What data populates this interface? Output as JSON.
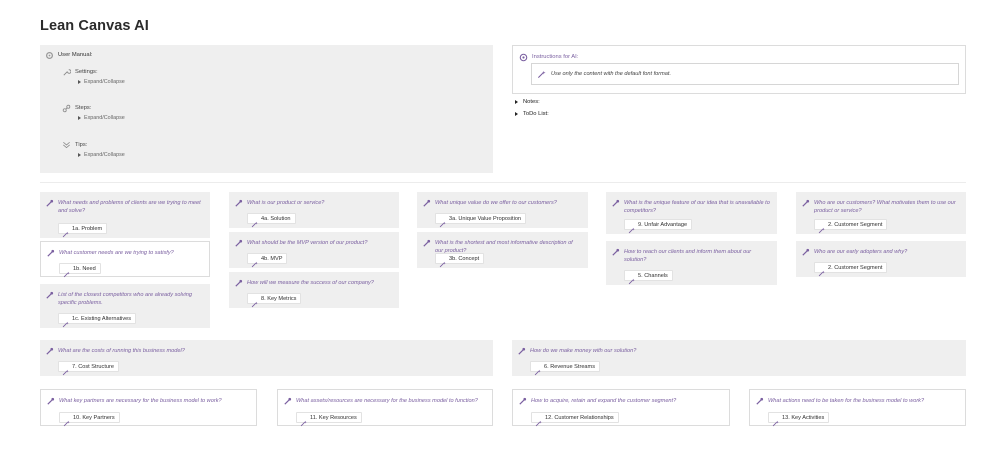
{
  "title": "Lean Canvas AI",
  "manual": {
    "label": "User Manual:",
    "sections": [
      {
        "label": "Settings:",
        "toggle": "Expand/Collapse"
      },
      {
        "label": "Steps:",
        "toggle": "Expand/Collapse"
      },
      {
        "label": "Tips:",
        "toggle": "Expand/Collapse"
      }
    ]
  },
  "ai": {
    "label": "Instructions for AI:",
    "input": "Use only the content with the default font format."
  },
  "toggles": {
    "notes": "Notes:",
    "todo": "ToDo List:"
  },
  "cards": {
    "problem": {
      "q": "What needs and problems of clients are we trying to meet and solve?",
      "chip": "1a. Problem"
    },
    "need": {
      "q": "What customer needs are we trying to satisfy?",
      "chip": "1b. Need"
    },
    "alternatives": {
      "q": "List of the closest competitors who are already solving specific problems.",
      "chip": "1c. Existing Alternatives"
    },
    "solution": {
      "q": "What is our product or service?",
      "chip": "4a. Solution"
    },
    "mvp": {
      "q": "What should be the MVP version of our product?",
      "chip": "4b. MVP"
    },
    "metrics": {
      "q": "How will we measure the success of our company?",
      "chip": "8. Key Metrics"
    },
    "uvp": {
      "q": "What unique value do we offer to our customers?",
      "chip": "3a. Unique Value Proposition"
    },
    "concept": {
      "q": "What is the shortest and most informative description of our product?",
      "chip": "3b. Concept"
    },
    "advantage": {
      "q": "What is the unique feature of our idea that is unavailable to competitors?",
      "chip": "9. Unfair Advantage"
    },
    "channels": {
      "q": "How to reach our clients and inform them about our solution?",
      "chip": "5. Channels"
    },
    "segment1": {
      "q": "Who are our customers? What motivates them to use our product or service?",
      "chip": "2. Customer Segment"
    },
    "segment2": {
      "q": "Who are our early adopters and why?",
      "chip": "2. Customer Segment"
    },
    "costs": {
      "q": "What are the costs of running this business model?",
      "chip": "7. Cost Structure"
    },
    "revenue": {
      "q": "How do we make money with our solution?",
      "chip": "6. Revenue Streams"
    },
    "partners": {
      "q": "What key partners are necessary for the business model to work?",
      "chip": "10. Key Partners"
    },
    "resources": {
      "q": "What assets/resources are necessary for the business model to function?",
      "chip": "11. Key Resources"
    },
    "relationships": {
      "q": "How to acquire, retain and expand the customer segment?",
      "chip": "12. Customer Relationships"
    },
    "activities": {
      "q": "What actions need to be taken for the business model to work?",
      "chip": "13. Key Activities"
    }
  },
  "colors": {
    "accent": "#7a5fa0",
    "panel": "#efefef",
    "border": "#dcdcdc"
  },
  "icons": {
    "card": "magic-wand-icon",
    "chip": "wand-sparkle-icon"
  }
}
